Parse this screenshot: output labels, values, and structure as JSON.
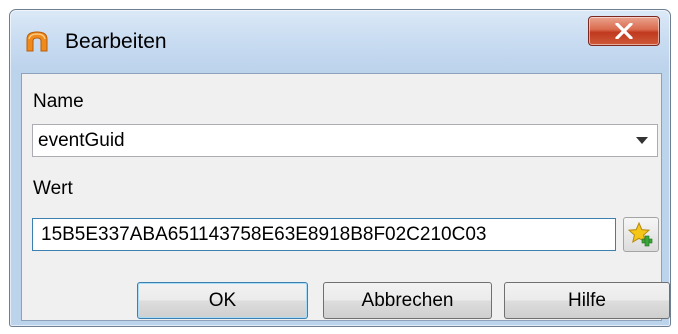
{
  "window": {
    "title": "Bearbeiten",
    "icon": "orange-arch-app-icon",
    "close_icon": "close-x-icon"
  },
  "form": {
    "name_label": "Name",
    "name_value": "eventGuid",
    "value_label": "Wert",
    "value_value": "15B5E337ABA651143758E63E8918B8F02C210C03",
    "add_icon": "star-plus-icon"
  },
  "buttons": {
    "ok": "OK",
    "cancel": "Abbrechen",
    "help": "Hilfe"
  },
  "colors": {
    "title_gradient": "#c9dcf1",
    "close_button": "#c0391f",
    "focus_border": "#3c7fb1",
    "app_icon": "#f08a1c",
    "star": "#f5c518",
    "plus": "#3aa63a"
  }
}
